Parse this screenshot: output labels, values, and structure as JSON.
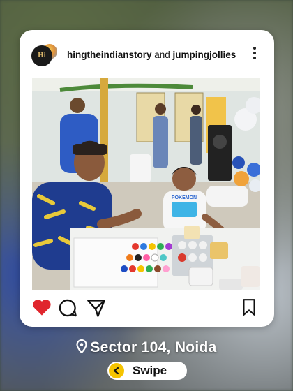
{
  "post": {
    "author_primary": "hingtheindianstory",
    "joiner": "and",
    "author_secondary": "jumpingjollies",
    "avatar_text": "Hi",
    "more_icon": "more-vertical-icon"
  },
  "actions": {
    "like_icon": "heart-icon",
    "like_color": "#e0262d",
    "comment_icon": "comment-icon",
    "share_icon": "send-icon",
    "save_icon": "bookmark-icon"
  },
  "photo": {
    "shirt_text": "POKEMON"
  },
  "footer": {
    "location": "Sector 104, Noida",
    "location_icon": "location-pin-icon",
    "swipe_label": "Swipe",
    "swipe_icon": "chevron-left-icon",
    "swipe_accent": "#f5c400"
  }
}
